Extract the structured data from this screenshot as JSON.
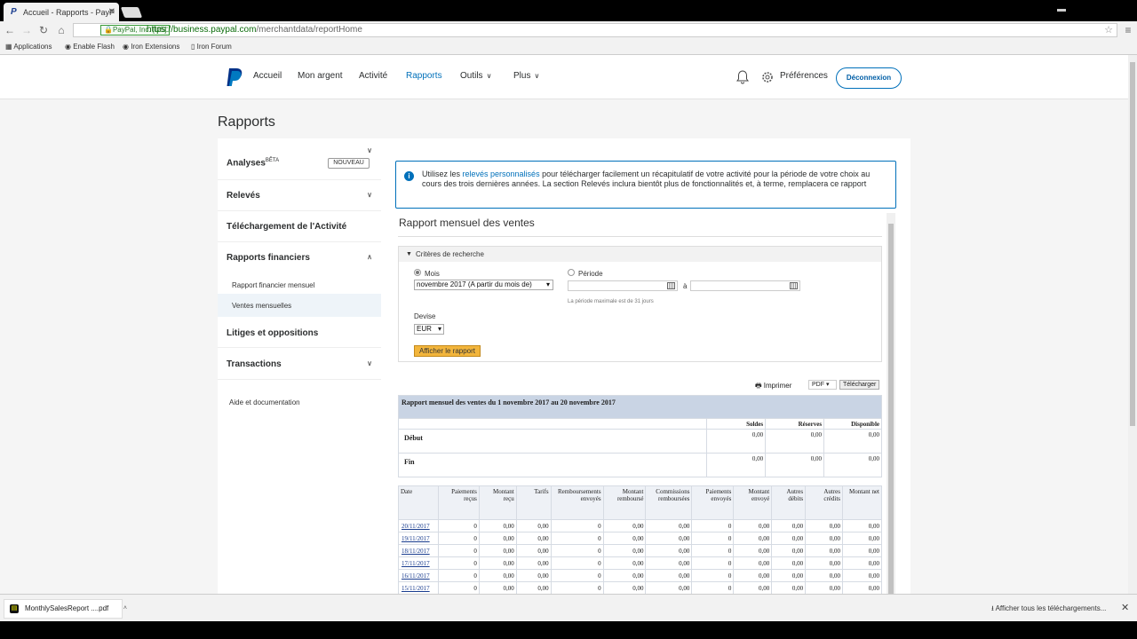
{
  "browser": {
    "tab_title": "Accueil - Rapports - PayP",
    "secure_label": "PayPal, Inc. [US]",
    "url_host": "https://business.paypal.com",
    "url_path": "/merchantdata/reportHome",
    "bookmarks": [
      "Applications",
      "Enable Flash",
      "Iron Extensions",
      "Iron Forum"
    ]
  },
  "header": {
    "nav": [
      "Accueil",
      "Mon argent",
      "Activité",
      "Rapports",
      "Outils",
      "Plus"
    ],
    "active": "Rapports",
    "preferences": "Préférences",
    "logout": "Déconnexion"
  },
  "page_title": "Rapports",
  "sidebar": {
    "analyses": "Analyses",
    "analyses_sup": "BÊTA",
    "badge": "NOUVEAU",
    "releves": "Relevés",
    "telechargement": "Téléchargement de l'Activité",
    "rapports_financiers": "Rapports financiers",
    "sub_mensuel": "Rapport financier mensuel",
    "sub_ventes": "Ventes mensuelles",
    "litiges": "Litiges et oppositions",
    "transactions": "Transactions",
    "aide": "Aide et documentation"
  },
  "info": {
    "pre": "Utilisez les ",
    "link": "relevés personnalisés",
    "post": " pour télécharger facilement un récapitulatif de votre activité pour la période de votre choix au cours des trois dernières années. La section Relevés inclura bientôt plus de fonctionnalités et, à terme, remplacera ce rapport"
  },
  "report": {
    "title": "Rapport mensuel des ventes",
    "criteria": "Critères de recherche",
    "mois": "Mois",
    "periode": "Période",
    "month_value": "novembre 2017 (A partir du mois de)",
    "a": "à",
    "hint": "La période maximale est de 31 jours",
    "devise": "Devise",
    "currency": "EUR",
    "show": "Afficher le rapport",
    "print": "Imprimer",
    "format": "PDF",
    "download": "Télécharger"
  },
  "summary": {
    "banner": "Rapport mensuel des ventes du 1 novembre 2017 au 20 novembre 2017",
    "cols": [
      "Soldes",
      "Réserves",
      "Disponible"
    ],
    "rows": [
      {
        "name": "Début",
        "values": [
          "0,00",
          "0,00",
          "0,00"
        ]
      },
      {
        "name": "Fin",
        "values": [
          "0,00",
          "0,00",
          "0,00"
        ]
      }
    ]
  },
  "detail": {
    "headers": [
      "Date",
      "Paiements reçus",
      "Montant reçu",
      "Tarifs",
      "Remboursements envoyés",
      "Montant remboursé",
      "Commissions remboursées",
      "Paiements envoyés",
      "Montant envoyé",
      "Autres débits",
      "Autres crédits",
      "Montant net"
    ],
    "rows": [
      [
        "20/11/2017",
        "0",
        "0,00",
        "0,00",
        "0",
        "0,00",
        "0,00",
        "0",
        "0,00",
        "0,00",
        "0,00",
        "0,00"
      ],
      [
        "19/11/2017",
        "0",
        "0,00",
        "0,00",
        "0",
        "0,00",
        "0,00",
        "0",
        "0,00",
        "0,00",
        "0,00",
        "0,00"
      ],
      [
        "18/11/2017",
        "0",
        "0,00",
        "0,00",
        "0",
        "0,00",
        "0,00",
        "0",
        "0,00",
        "0,00",
        "0,00",
        "0,00"
      ],
      [
        "17/11/2017",
        "0",
        "0,00",
        "0,00",
        "0",
        "0,00",
        "0,00",
        "0",
        "0,00",
        "0,00",
        "0,00",
        "0,00"
      ],
      [
        "16/11/2017",
        "0",
        "0,00",
        "0,00",
        "0",
        "0,00",
        "0,00",
        "0",
        "0,00",
        "0,00",
        "0,00",
        "0,00"
      ],
      [
        "15/11/2017",
        "0",
        "0,00",
        "0,00",
        "0",
        "0,00",
        "0,00",
        "0",
        "0,00",
        "0,00",
        "0,00",
        "0,00"
      ]
    ]
  },
  "downloads": {
    "file": "MonthlySalesReport ....pdf",
    "show_all": "Afficher tous les téléchargements..."
  },
  "colors": {
    "brand_blue": "#0070ba",
    "accent_button": "#f2b53c",
    "table_banner": "#c9d4e4"
  }
}
